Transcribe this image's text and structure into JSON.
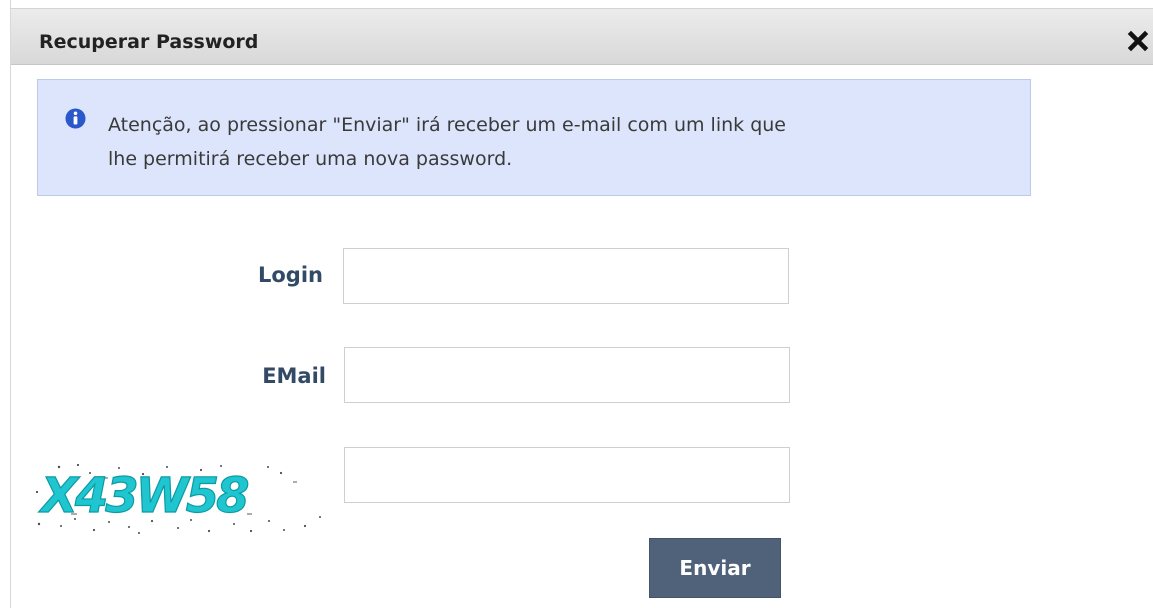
{
  "dialog": {
    "title": "Recuperar Password",
    "close_icon": "close-icon"
  },
  "alert": {
    "icon": "info-icon",
    "line1": "Atenção, ao pressionar \"Enviar\" irá receber um e-mail com um link que",
    "line2": "lhe permitirá receber uma nova password."
  },
  "form": {
    "login_label": "Login",
    "login_value": "",
    "email_label": "EMail",
    "email_value": "",
    "captcha_text": "X43W58",
    "captcha_value": "",
    "submit_label": "Enviar"
  },
  "colors": {
    "alert_bg": "#dce5fb",
    "label_color": "#334a66",
    "button_bg": "#4f627a",
    "captcha_color": "#1fc6cf"
  }
}
